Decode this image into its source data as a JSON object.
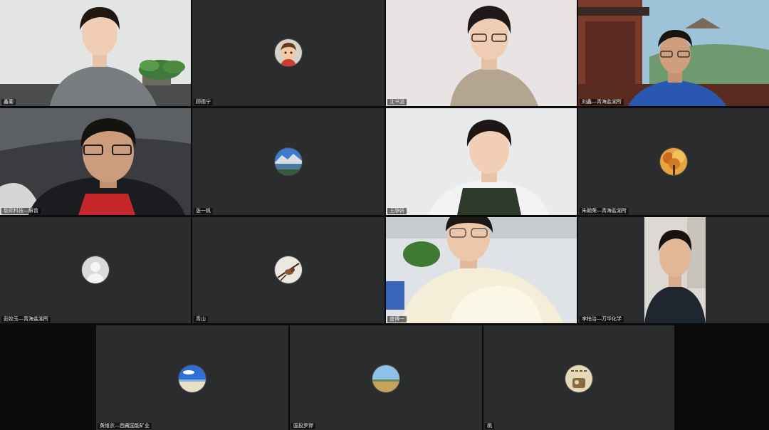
{
  "meeting": {
    "participants": [
      {
        "name": "鑫葡",
        "video": "woman-office"
      },
      {
        "name": "顾雨宁",
        "avatar": "cartoon-boy-avatar"
      },
      {
        "name": "沈书涵",
        "video": "young-man-glasses"
      },
      {
        "name": "刘鑫—青海盐湖所",
        "video": "man-palace-backdrop"
      },
      {
        "name": "能熙科技—解曾",
        "video": "man-glasses-closeup"
      },
      {
        "name": "张一帆",
        "avatar": "lake-landscape-avatar"
      },
      {
        "name": "王静妍",
        "video": "woman-vest"
      },
      {
        "name": "朱朝荣—青海盐湖所",
        "avatar": "autumn-tree-avatar"
      },
      {
        "name": "彭姣玉—青海盐湖所",
        "avatar": "default-avatar"
      },
      {
        "name": "青山",
        "avatar": "bird-branch-avatar"
      },
      {
        "name": "盛博一",
        "video": "woman-white-coat"
      },
      {
        "name": "李柏治—万华化学",
        "video": "young-man-portrait"
      },
      {
        "name": "黄维农—西藏国能矿业",
        "avatar": "sky-beach-avatar"
      },
      {
        "name": "国投罗钾",
        "avatar": "plain-landscape-avatar"
      },
      {
        "name": "桃",
        "avatar": "calligraphy-avatar"
      }
    ]
  },
  "colors": {
    "tile_bg": "#2b2c2e",
    "page_bg": "#0b0b0c",
    "active_speaker": "#6bd17a"
  }
}
